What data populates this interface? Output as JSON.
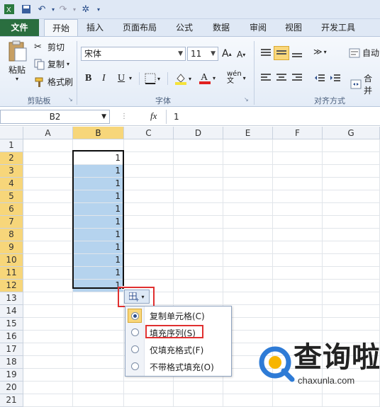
{
  "tabs": [
    "文件",
    "开始",
    "插入",
    "页面布局",
    "公式",
    "数据",
    "审阅",
    "视图",
    "开发工具"
  ],
  "clipboard": {
    "paste": "粘贴",
    "cut": "剪切",
    "copy": "复制",
    "format_painter": "格式刷",
    "label": "剪贴板"
  },
  "font": {
    "name": "宋体",
    "size": "11",
    "label": "字体",
    "bold": "B",
    "italic": "I",
    "underline": "U"
  },
  "align": {
    "label": "对齐方式",
    "wrap": "自动",
    "merge": "合并"
  },
  "formula_bar": {
    "name_box": "B2",
    "fx": "fx",
    "value": "1"
  },
  "columns": [
    "A",
    "B",
    "C",
    "D",
    "E",
    "F",
    "G"
  ],
  "rows": [
    "1",
    "2",
    "3",
    "4",
    "5",
    "6",
    "7",
    "8",
    "9",
    "10",
    "11",
    "12",
    "13",
    "14",
    "15",
    "16",
    "17",
    "18",
    "19",
    "20",
    "21"
  ],
  "column_b_values": [
    "1",
    "1",
    "1",
    "1",
    "1",
    "1",
    "1",
    "1",
    "1",
    "1",
    "1"
  ],
  "autofill_menu": [
    {
      "label": "复制单元格(C)",
      "selected": true
    },
    {
      "label": "填充序列(S)",
      "selected": false
    },
    {
      "label": "仅填充格式(F)",
      "selected": false
    },
    {
      "label": "不带格式填充(O)",
      "selected": false
    }
  ],
  "watermark": {
    "text": "查询啦",
    "url": "chaxunla.com"
  },
  "colors": {
    "selection_fill": "#b5d3ee",
    "header_highlight": "#f7d67a",
    "red_highlight": "#e03030",
    "file_tab": "#2a6e3f"
  }
}
